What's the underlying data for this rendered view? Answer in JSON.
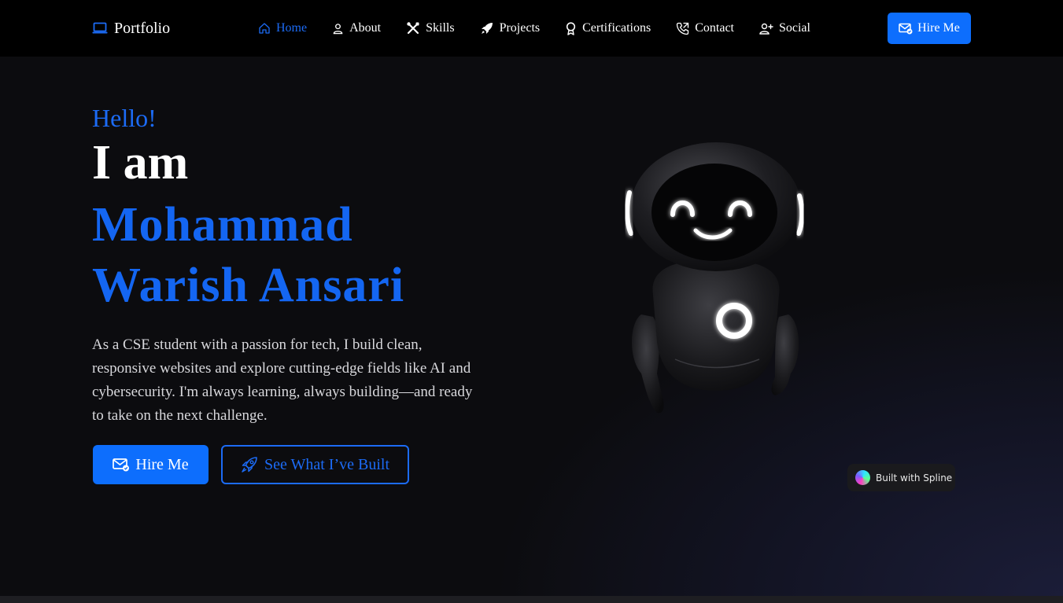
{
  "navbar": {
    "brand": "Portfolio",
    "links": [
      {
        "label": "Home",
        "icon": "home-icon",
        "active": true
      },
      {
        "label": "About",
        "icon": "user-icon",
        "active": false
      },
      {
        "label": "Skills",
        "icon": "tools-icon",
        "active": false
      },
      {
        "label": "Projects",
        "icon": "rocket-icon",
        "active": false
      },
      {
        "label": "Certifications",
        "icon": "award-icon",
        "active": false
      },
      {
        "label": "Contact",
        "icon": "phone-icon",
        "active": false
      },
      {
        "label": "Social",
        "icon": "user-plus-icon",
        "active": false
      }
    ],
    "hire_label": "Hire Me"
  },
  "hero": {
    "greeting": "Hello!",
    "intro": "I am",
    "name_line1": "Mohammad",
    "name_line2": "Warish Ansari",
    "bio": "As a CSE student with a passion for tech, I build clean, responsive websites and explore cutting-edge fields like AI and cybersecurity. I'm always learning, always building—and ready to take on the next challenge.",
    "primary_button": "Hire Me",
    "secondary_button": "See What I’ve Built"
  },
  "spline_badge": {
    "label": "Built with Spline"
  },
  "colors": {
    "accent": "#0d6efd",
    "accent_text": "#1466f2",
    "background": "#0c0c0f",
    "navbar_bg": "#000000"
  }
}
